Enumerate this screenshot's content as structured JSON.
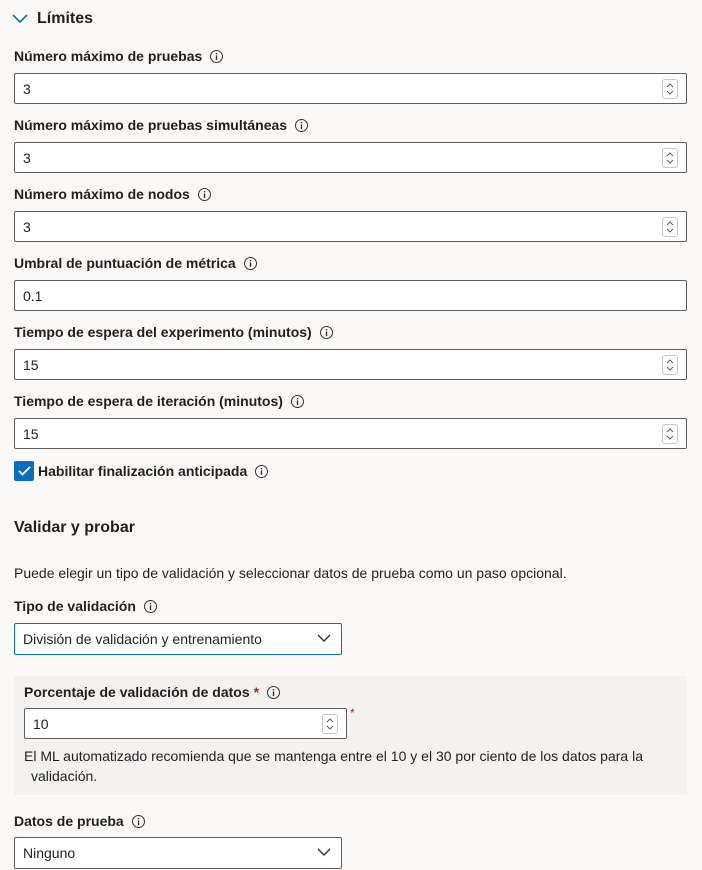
{
  "limits": {
    "title": "Límites",
    "fields": [
      {
        "label": "Número máximo de pruebas",
        "value": "3",
        "stepper": true
      },
      {
        "label": "Número máximo de pruebas simultáneas",
        "value": "3",
        "stepper": true
      },
      {
        "label": "Número máximo de nodos",
        "value": "3",
        "stepper": true
      },
      {
        "label": "Umbral de puntuación de métrica",
        "value": "0.1",
        "stepper": false
      },
      {
        "label": "Tiempo de espera del experimento (minutos)",
        "value": "15",
        "stepper": true
      },
      {
        "label": "Tiempo de espera de iteración (minutos)",
        "value": "15",
        "stepper": true
      }
    ],
    "early_termination": {
      "label": "Habilitar finalización anticipada",
      "checked": true
    }
  },
  "validate": {
    "title": "Validar y probar",
    "description": "Puede elegir un tipo de validación y seleccionar datos de prueba como un paso opcional.",
    "validation_type": {
      "label": "Tipo de validación",
      "value": "División de validación y entrenamiento"
    },
    "validation_percentage": {
      "label": "Porcentaje de validación de datos",
      "required_mark": "*",
      "value": "10",
      "hint_line1": "El ML automatizado recomienda que se mantenga entre el 10 y el 30 por ciento de los datos para la",
      "hint_line2": "validación."
    },
    "test_data": {
      "label": "Datos de prueba",
      "value": "Ninguno"
    }
  },
  "colors": {
    "accent": "#0f6cbd",
    "required": "#a4262c",
    "panel": "#f3f2f1"
  }
}
